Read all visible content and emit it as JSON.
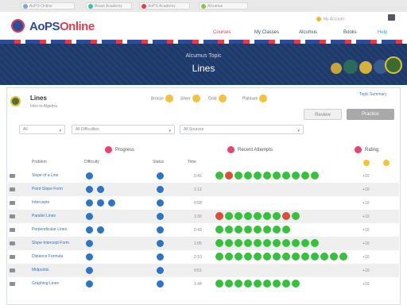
{
  "topbar": {
    "items": [
      {
        "label": "AoPS Online",
        "color": "#7aa6d8"
      },
      {
        "label": "Beast Academy",
        "color": "#3cc0a8"
      },
      {
        "label": "AoPS Academy",
        "color": "#e23a4e"
      },
      {
        "label": "Alcumus",
        "color": "#8bc34a"
      }
    ]
  },
  "header": {
    "logo_main": "AoPS",
    "logo_accent": "Online",
    "account_link": "My Account",
    "nav": [
      "Courses",
      "My Classes",
      "Alcumus",
      "Books",
      "Help"
    ]
  },
  "banner": {
    "subtitle": "Alcumus Topic",
    "title": "Lines"
  },
  "course": {
    "title": "Lines",
    "subtitle": "Intro to Algebra",
    "medals": [
      "Bronze",
      "Silver",
      "Gold",
      "Platinum"
    ],
    "link": "Topic Summary",
    "btn_secondary": "Review",
    "btn_primary": "Practice"
  },
  "filters": {
    "select1": "All",
    "select2": "All Difficulties",
    "select3": "All Sources"
  },
  "groups": {
    "progress": "Progress",
    "recent": "Recent Attempts",
    "rating": "Rating"
  },
  "columns": {
    "problem": "Problem",
    "difficulty": "Difficulty",
    "status": "Status",
    "time": "Time"
  },
  "rows": [
    {
      "name": "Slope of a Line",
      "difficulty": 1,
      "status": "blue",
      "time": "0:45",
      "attempts": [
        "g",
        "r",
        "g",
        "g",
        "g",
        "g",
        "g",
        "g",
        "g",
        "g",
        "g"
      ],
      "points": "+10"
    },
    {
      "name": "Point-Slope Form",
      "difficulty": 2,
      "status": "blue",
      "time": "1:12",
      "attempts": [],
      "points": "+10"
    },
    {
      "name": "Intercepts",
      "difficulty": 3,
      "status": "blue",
      "time": "0:58",
      "attempts": [],
      "points": "+10"
    },
    {
      "name": "Parallel Lines",
      "difficulty": 1,
      "status": "blue",
      "time": "1:30",
      "attempts": [
        "r",
        "g",
        "g",
        "g",
        "g",
        "g",
        "g",
        "r",
        "g"
      ],
      "points": "+10"
    },
    {
      "name": "Perpendicular Lines",
      "difficulty": 2,
      "status": "blue",
      "time": "0:49",
      "attempts": [
        "g",
        "g",
        "g",
        "g",
        "g",
        "g",
        "g",
        "g"
      ],
      "points": "+10"
    },
    {
      "name": "Slope-Intercept Form",
      "difficulty": 1,
      "status": "blue",
      "time": "1:05",
      "attempts": [
        "g",
        "g",
        "g",
        "g",
        "g",
        "g",
        "g",
        "g",
        "g",
        "g",
        "g"
      ],
      "points": "+10"
    },
    {
      "name": "Distance Formula",
      "difficulty": 1,
      "status": "blue",
      "time": "2:10",
      "attempts": [
        "g",
        "g",
        "g",
        "g",
        "g",
        "g",
        "g",
        "g",
        "g",
        "g",
        "g",
        "g",
        "g",
        "g"
      ],
      "points": "+10"
    },
    {
      "name": "Midpoints",
      "difficulty": 1,
      "status": "blue",
      "time": "0:51",
      "attempts": [],
      "points": "+10"
    },
    {
      "name": "Graphing Lines",
      "difficulty": 1,
      "status": "blue",
      "time": "1:44",
      "attempts": [
        "g",
        "g",
        "g",
        "g",
        "g",
        "g",
        "g",
        "g",
        "g"
      ],
      "points": "+10"
    }
  ]
}
